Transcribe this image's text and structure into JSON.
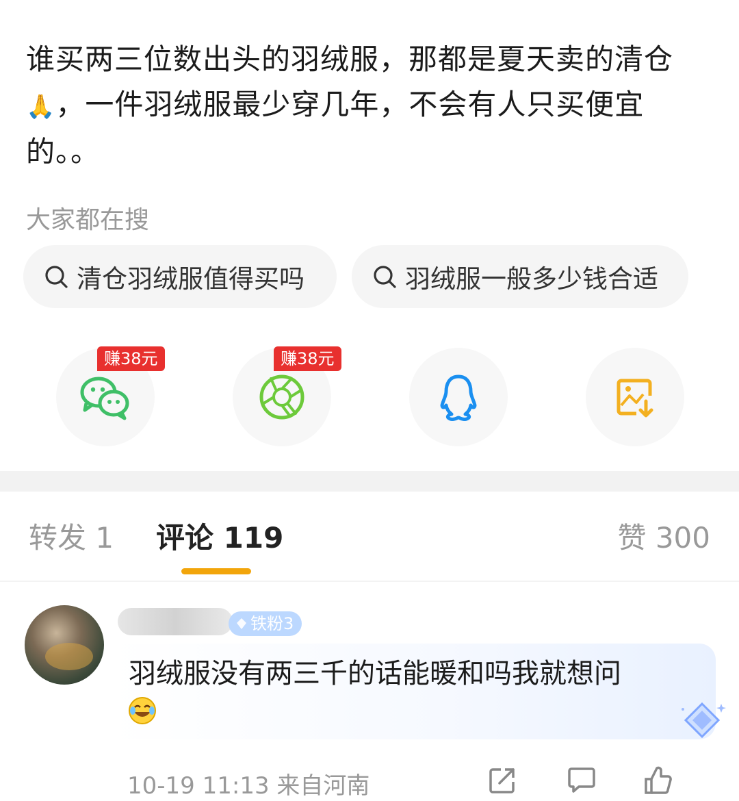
{
  "post": {
    "line1": "谁买两三位数出头的羽绒服，那都是夏天卖的清仓",
    "line2": "，一件羽绒服最少穿几年，不会有人只买便宜",
    "line3": "的。。"
  },
  "search_section": {
    "label": "大家都在搜",
    "chips": [
      "清仓羽绒服值得买吗",
      "羽绒服一般多少钱合适"
    ]
  },
  "share_bar": {
    "reward_badge": "赚38元",
    "icons": [
      "wechat-icon",
      "moments-icon",
      "qq-icon",
      "save-image-icon"
    ],
    "colors": {
      "wechat": "#3fbf67",
      "moments": "#6dca3b",
      "qq": "#1a8ff0",
      "save": "#f3b020",
      "reward": "#e8302e"
    }
  },
  "tabs": {
    "repost": "转发 1",
    "comments": "评论 119",
    "likes": "赞 300",
    "accent": "#f2a50b"
  },
  "comment": {
    "fan_badge": "铁粉3",
    "text": "羽绒服没有两三千的话能暖和吗我就想问",
    "time": "10-19 11:13",
    "location": "来自河南"
  }
}
